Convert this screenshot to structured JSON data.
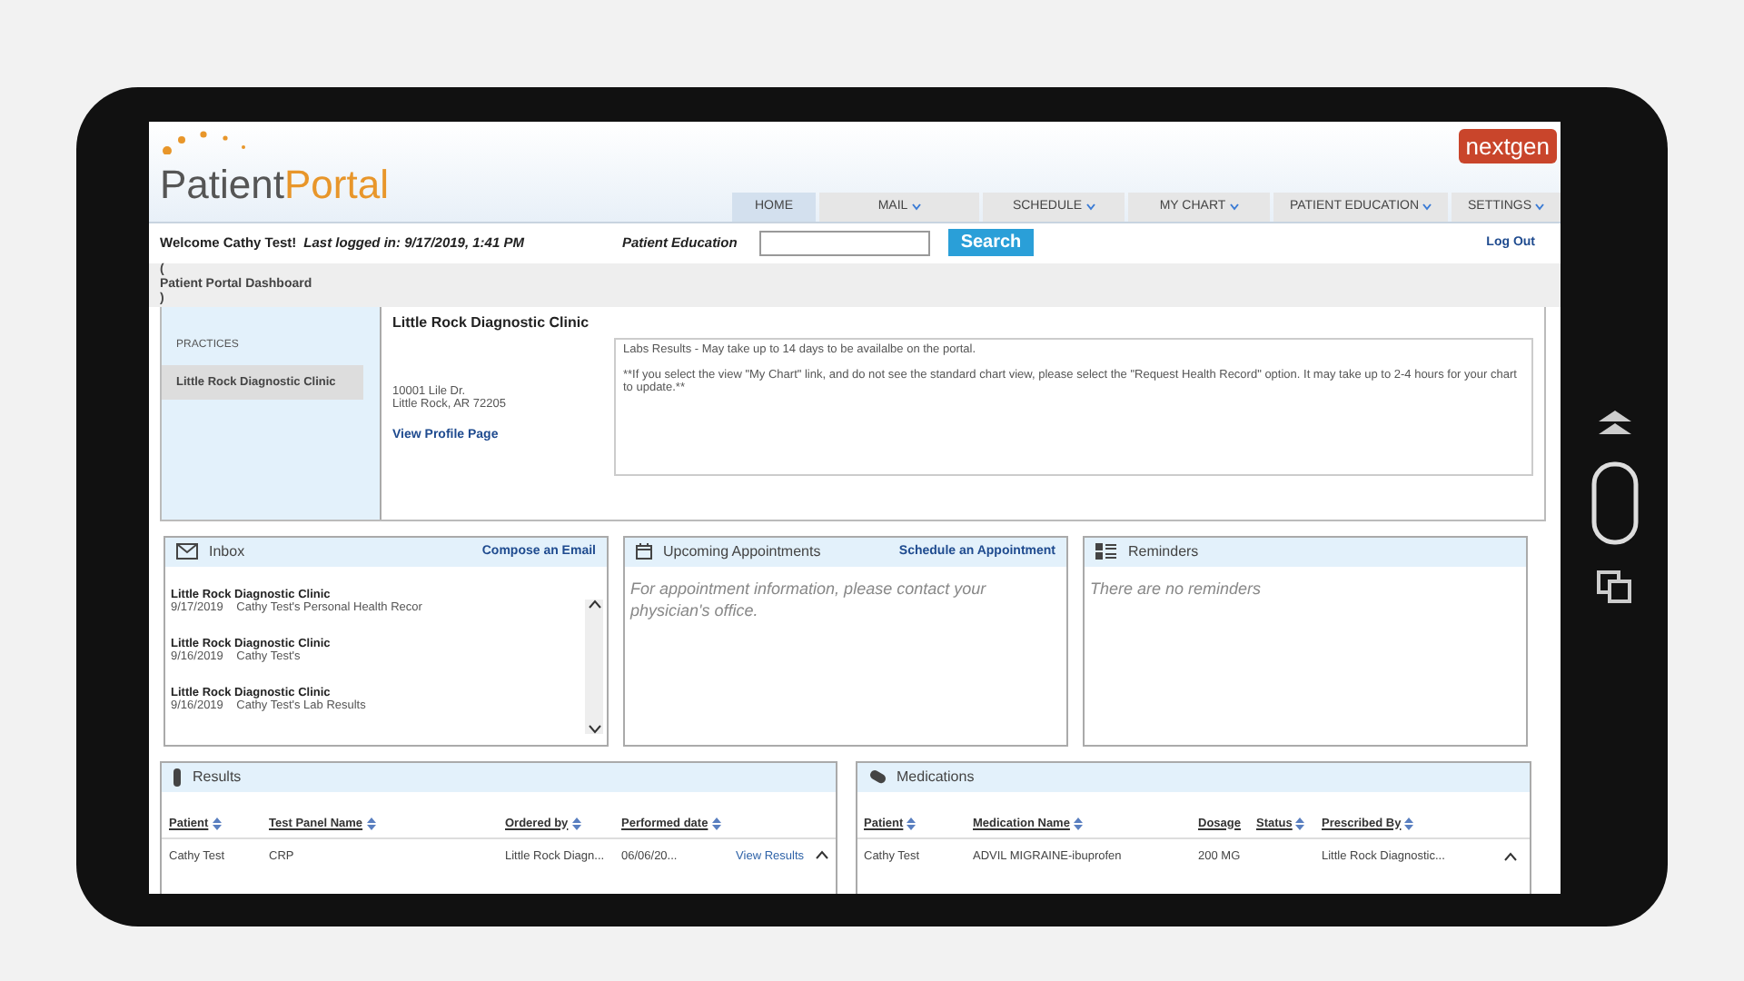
{
  "header": {
    "logo_main": "Patient",
    "logo_accent": "Portal",
    "brand": "nextgen",
    "nav": [
      {
        "label": "HOME",
        "selected": true,
        "dropdown": false
      },
      {
        "label": "MAIL",
        "selected": false,
        "dropdown": true
      },
      {
        "label": "SCHEDULE",
        "selected": false,
        "dropdown": true
      },
      {
        "label": "MY CHART",
        "selected": false,
        "dropdown": true
      },
      {
        "label": "PATIENT EDUCATION",
        "selected": false,
        "dropdown": true
      },
      {
        "label": "SETTINGS",
        "selected": false,
        "dropdown": true
      }
    ]
  },
  "welcome": {
    "greeting": "Welcome Cathy Test!",
    "last_login": "Last logged in: 9/17/2019, 1:41 PM",
    "search_label": "Patient Education",
    "search_button": "Search",
    "logout": "Log Out"
  },
  "breadcrumb": {
    "open": "(",
    "title": "Patient Portal Dashboard",
    "close": ")"
  },
  "practice": {
    "heading": "PRACTICES",
    "items": [
      {
        "label": "Little Rock Diagnostic Clinic",
        "selected": true
      }
    ],
    "name": "Little Rock Diagnostic Clinic",
    "address": [
      "10001 Lile Dr.",
      "Little Rock, AR 72205"
    ],
    "profile_link": "View Profile Page",
    "notes": [
      "Labs Results - May take up to 14 days to be availalbe on the portal.",
      "**If you select the view \"My Chart\" link, and do not see the standard chart view, please select the \"Request Health Record\" option. It may take up to 2-4 hours for your chart to update.**"
    ]
  },
  "inbox": {
    "title": "Inbox",
    "action": "Compose an Email",
    "messages": [
      {
        "from": "Little Rock Diagnostic Clinic",
        "date": "9/17/2019",
        "subject": "Cathy Test's Personal Health Recor"
      },
      {
        "from": "Little Rock Diagnostic Clinic",
        "date": "9/16/2019",
        "subject": "Cathy Test's"
      },
      {
        "from": "Little Rock Diagnostic Clinic",
        "date": "9/16/2019",
        "subject": "Cathy Test's Lab Results"
      }
    ]
  },
  "appointments": {
    "title": "Upcoming Appointments",
    "action": "Schedule an Appointment",
    "message": "For appointment information, please contact your physician's office."
  },
  "reminders": {
    "title": "Reminders",
    "message": "There are no reminders"
  },
  "results": {
    "title": "Results",
    "columns": [
      {
        "label": "Patient",
        "sortable": true
      },
      {
        "label": "Test Panel Name",
        "sortable": true
      },
      {
        "label": "Ordered by",
        "sortable": true
      },
      {
        "label": "Performed date",
        "sortable": true
      }
    ],
    "rows": [
      {
        "cells": [
          "Cathy Test",
          "CRP",
          "Little Rock Diagn...",
          "06/06/20..."
        ],
        "link": "View Results"
      }
    ]
  },
  "medications": {
    "title": "Medications",
    "columns": [
      {
        "label": "Patient",
        "sortable": true
      },
      {
        "label": "Medication Name",
        "sortable": true
      },
      {
        "label": "Dosage",
        "sortable": false
      },
      {
        "label": "Status",
        "sortable": true
      },
      {
        "label": "Prescribed By",
        "sortable": true
      }
    ],
    "rows": [
      {
        "cells": [
          "Cathy Test",
          "ADVIL MIGRAINE-ibuprofen",
          "200 MG",
          "",
          "Little Rock Diagnostic..."
        ]
      }
    ]
  }
}
